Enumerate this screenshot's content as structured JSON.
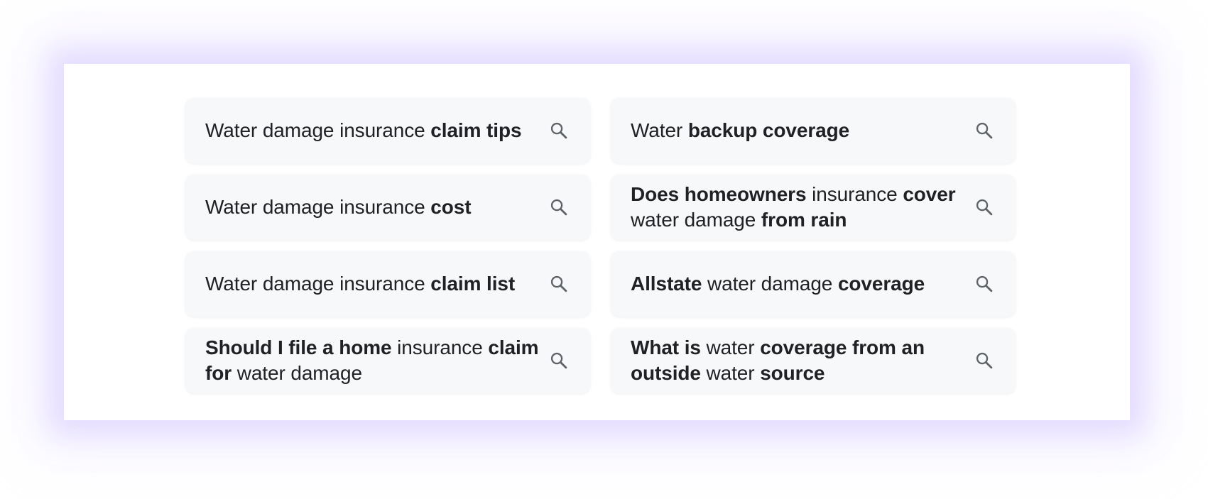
{
  "suggestions": [
    {
      "segments": [
        {
          "text": "Water damage insurance ",
          "bold": false
        },
        {
          "text": "claim tips",
          "bold": true
        }
      ],
      "icon": "search-icon"
    },
    {
      "segments": [
        {
          "text": "Water ",
          "bold": false
        },
        {
          "text": "backup coverage",
          "bold": true
        }
      ],
      "icon": "search-icon"
    },
    {
      "segments": [
        {
          "text": "Water damage insurance ",
          "bold": false
        },
        {
          "text": "cost",
          "bold": true
        }
      ],
      "icon": "search-icon"
    },
    {
      "segments": [
        {
          "text": "Does homeowners",
          "bold": true
        },
        {
          "text": " insurance ",
          "bold": false
        },
        {
          "text": "cover",
          "bold": true
        },
        {
          "text": " water damage ",
          "bold": false
        },
        {
          "text": "from rain",
          "bold": true
        }
      ],
      "icon": "search-icon"
    },
    {
      "segments": [
        {
          "text": "Water damage insurance ",
          "bold": false
        },
        {
          "text": "claim list",
          "bold": true
        }
      ],
      "icon": "search-icon"
    },
    {
      "segments": [
        {
          "text": "Allstate",
          "bold": true
        },
        {
          "text": " water damage ",
          "bold": false
        },
        {
          "text": "coverage",
          "bold": true
        }
      ],
      "icon": "search-icon"
    },
    {
      "segments": [
        {
          "text": "Should I file a home",
          "bold": true
        },
        {
          "text": " insurance ",
          "bold": false
        },
        {
          "text": "claim for",
          "bold": true
        },
        {
          "text": " water damage",
          "bold": false
        }
      ],
      "icon": "search-icon"
    },
    {
      "segments": [
        {
          "text": "What is",
          "bold": true
        },
        {
          "text": " water ",
          "bold": false
        },
        {
          "text": "coverage from an outside",
          "bold": true
        },
        {
          "text": " water ",
          "bold": false
        },
        {
          "text": "source",
          "bold": true
        }
      ],
      "icon": "search-icon"
    }
  ],
  "colors": {
    "chip_background": "#f7f8fa",
    "text": "#202124",
    "icon": "#5f6368",
    "glow": "#d4c8ff"
  }
}
